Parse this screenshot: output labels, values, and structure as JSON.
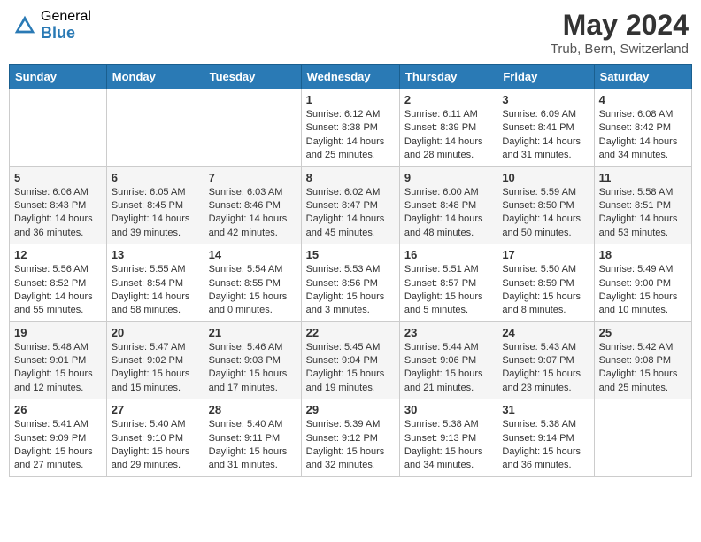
{
  "header": {
    "logo_general": "General",
    "logo_blue": "Blue",
    "title": "May 2024",
    "subtitle": "Trub, Bern, Switzerland"
  },
  "days_of_week": [
    "Sunday",
    "Monday",
    "Tuesday",
    "Wednesday",
    "Thursday",
    "Friday",
    "Saturday"
  ],
  "weeks": [
    [
      {
        "day": "",
        "info": ""
      },
      {
        "day": "",
        "info": ""
      },
      {
        "day": "",
        "info": ""
      },
      {
        "day": "1",
        "info": "Sunrise: 6:12 AM\nSunset: 8:38 PM\nDaylight: 14 hours and 25 minutes."
      },
      {
        "day": "2",
        "info": "Sunrise: 6:11 AM\nSunset: 8:39 PM\nDaylight: 14 hours and 28 minutes."
      },
      {
        "day": "3",
        "info": "Sunrise: 6:09 AM\nSunset: 8:41 PM\nDaylight: 14 hours and 31 minutes."
      },
      {
        "day": "4",
        "info": "Sunrise: 6:08 AM\nSunset: 8:42 PM\nDaylight: 14 hours and 34 minutes."
      }
    ],
    [
      {
        "day": "5",
        "info": "Sunrise: 6:06 AM\nSunset: 8:43 PM\nDaylight: 14 hours and 36 minutes."
      },
      {
        "day": "6",
        "info": "Sunrise: 6:05 AM\nSunset: 8:45 PM\nDaylight: 14 hours and 39 minutes."
      },
      {
        "day": "7",
        "info": "Sunrise: 6:03 AM\nSunset: 8:46 PM\nDaylight: 14 hours and 42 minutes."
      },
      {
        "day": "8",
        "info": "Sunrise: 6:02 AM\nSunset: 8:47 PM\nDaylight: 14 hours and 45 minutes."
      },
      {
        "day": "9",
        "info": "Sunrise: 6:00 AM\nSunset: 8:48 PM\nDaylight: 14 hours and 48 minutes."
      },
      {
        "day": "10",
        "info": "Sunrise: 5:59 AM\nSunset: 8:50 PM\nDaylight: 14 hours and 50 minutes."
      },
      {
        "day": "11",
        "info": "Sunrise: 5:58 AM\nSunset: 8:51 PM\nDaylight: 14 hours and 53 minutes."
      }
    ],
    [
      {
        "day": "12",
        "info": "Sunrise: 5:56 AM\nSunset: 8:52 PM\nDaylight: 14 hours and 55 minutes."
      },
      {
        "day": "13",
        "info": "Sunrise: 5:55 AM\nSunset: 8:54 PM\nDaylight: 14 hours and 58 minutes."
      },
      {
        "day": "14",
        "info": "Sunrise: 5:54 AM\nSunset: 8:55 PM\nDaylight: 15 hours and 0 minutes."
      },
      {
        "day": "15",
        "info": "Sunrise: 5:53 AM\nSunset: 8:56 PM\nDaylight: 15 hours and 3 minutes."
      },
      {
        "day": "16",
        "info": "Sunrise: 5:51 AM\nSunset: 8:57 PM\nDaylight: 15 hours and 5 minutes."
      },
      {
        "day": "17",
        "info": "Sunrise: 5:50 AM\nSunset: 8:59 PM\nDaylight: 15 hours and 8 minutes."
      },
      {
        "day": "18",
        "info": "Sunrise: 5:49 AM\nSunset: 9:00 PM\nDaylight: 15 hours and 10 minutes."
      }
    ],
    [
      {
        "day": "19",
        "info": "Sunrise: 5:48 AM\nSunset: 9:01 PM\nDaylight: 15 hours and 12 minutes."
      },
      {
        "day": "20",
        "info": "Sunrise: 5:47 AM\nSunset: 9:02 PM\nDaylight: 15 hours and 15 minutes."
      },
      {
        "day": "21",
        "info": "Sunrise: 5:46 AM\nSunset: 9:03 PM\nDaylight: 15 hours and 17 minutes."
      },
      {
        "day": "22",
        "info": "Sunrise: 5:45 AM\nSunset: 9:04 PM\nDaylight: 15 hours and 19 minutes."
      },
      {
        "day": "23",
        "info": "Sunrise: 5:44 AM\nSunset: 9:06 PM\nDaylight: 15 hours and 21 minutes."
      },
      {
        "day": "24",
        "info": "Sunrise: 5:43 AM\nSunset: 9:07 PM\nDaylight: 15 hours and 23 minutes."
      },
      {
        "day": "25",
        "info": "Sunrise: 5:42 AM\nSunset: 9:08 PM\nDaylight: 15 hours and 25 minutes."
      }
    ],
    [
      {
        "day": "26",
        "info": "Sunrise: 5:41 AM\nSunset: 9:09 PM\nDaylight: 15 hours and 27 minutes."
      },
      {
        "day": "27",
        "info": "Sunrise: 5:40 AM\nSunset: 9:10 PM\nDaylight: 15 hours and 29 minutes."
      },
      {
        "day": "28",
        "info": "Sunrise: 5:40 AM\nSunset: 9:11 PM\nDaylight: 15 hours and 31 minutes."
      },
      {
        "day": "29",
        "info": "Sunrise: 5:39 AM\nSunset: 9:12 PM\nDaylight: 15 hours and 32 minutes."
      },
      {
        "day": "30",
        "info": "Sunrise: 5:38 AM\nSunset: 9:13 PM\nDaylight: 15 hours and 34 minutes."
      },
      {
        "day": "31",
        "info": "Sunrise: 5:38 AM\nSunset: 9:14 PM\nDaylight: 15 hours and 36 minutes."
      },
      {
        "day": "",
        "info": ""
      }
    ]
  ]
}
